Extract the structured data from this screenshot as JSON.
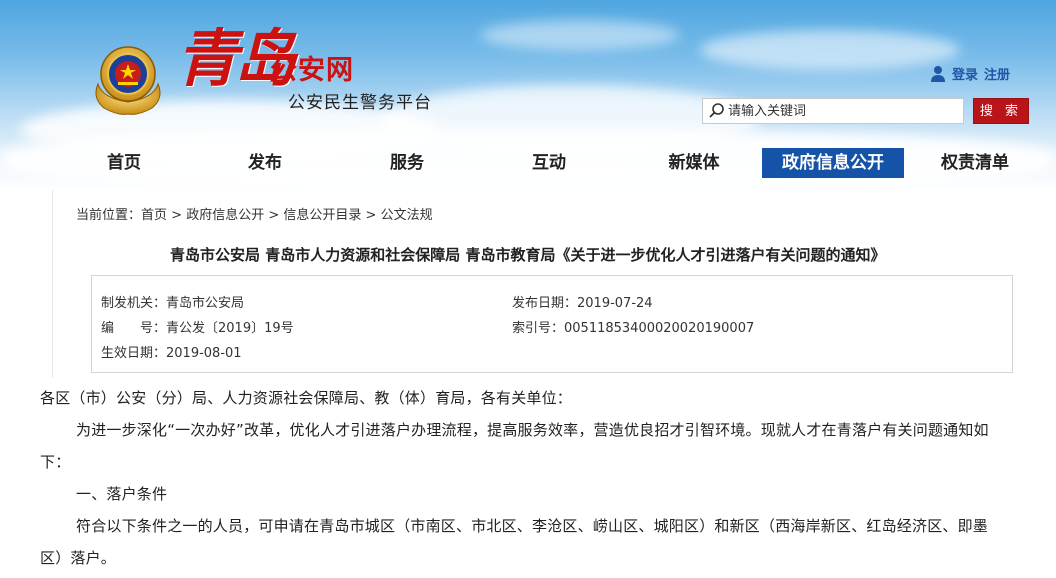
{
  "header": {
    "logo_text": "青岛",
    "site_name": "公安网",
    "site_subtitle": "公安民生警务平台",
    "login_label": "登录",
    "register_label": "注册",
    "search_placeholder": "请输入关键词",
    "search_button": "搜 索",
    "colors": {
      "brand_red": "#cc1111",
      "nav_active": "#1553a8",
      "button_red": "#b9141a"
    }
  },
  "nav": {
    "items": [
      {
        "label": "首页"
      },
      {
        "label": "发布"
      },
      {
        "label": "服务"
      },
      {
        "label": "互动"
      },
      {
        "label": "新媒体"
      },
      {
        "label": "政府信息公开",
        "active": true
      },
      {
        "label": "权责清单"
      }
    ]
  },
  "breadcrumb": {
    "prefix": "当前位置：",
    "items": [
      "首页",
      "政府信息公开",
      "信息公开目录",
      "公文法规"
    ],
    "separator": " > "
  },
  "document": {
    "title": "青岛市公安局 青岛市人力资源和社会保障局 青岛市教育局《关于进一步优化人才引进落户有关问题的通知》",
    "meta": {
      "issuer_label": "制发机关：",
      "issuer": "青岛市公安局",
      "publish_label": "发布日期：",
      "publish_date": "2019-07-24",
      "number_label": "编　　号：",
      "number": "青公发〔2019〕19号",
      "index_label": "索引号：",
      "index": "00511853400020020190007",
      "effective_label": "生效日期：",
      "effective_date": "2019-08-01"
    },
    "body": {
      "salutation": "各区（市）公安（分）局、人力资源社会保障局、教（体）育局，各有关单位：",
      "para1_line1": "为进一步深化“一次办好”改革，优化人才引进落户办理流程，提高服务效率，营造优良招才引智环境。现就人才在青落户有关问题通知如",
      "para1_line2": "下：",
      "section1": "一、落户条件",
      "para2_line1": "符合以下条件之一的人员，可申请在青岛市城区（市南区、市北区、李沧区、崂山区、城阳区）和新区（西海岸新区、红岛经济区、即墨",
      "para2_line2": "区）落户。"
    }
  }
}
